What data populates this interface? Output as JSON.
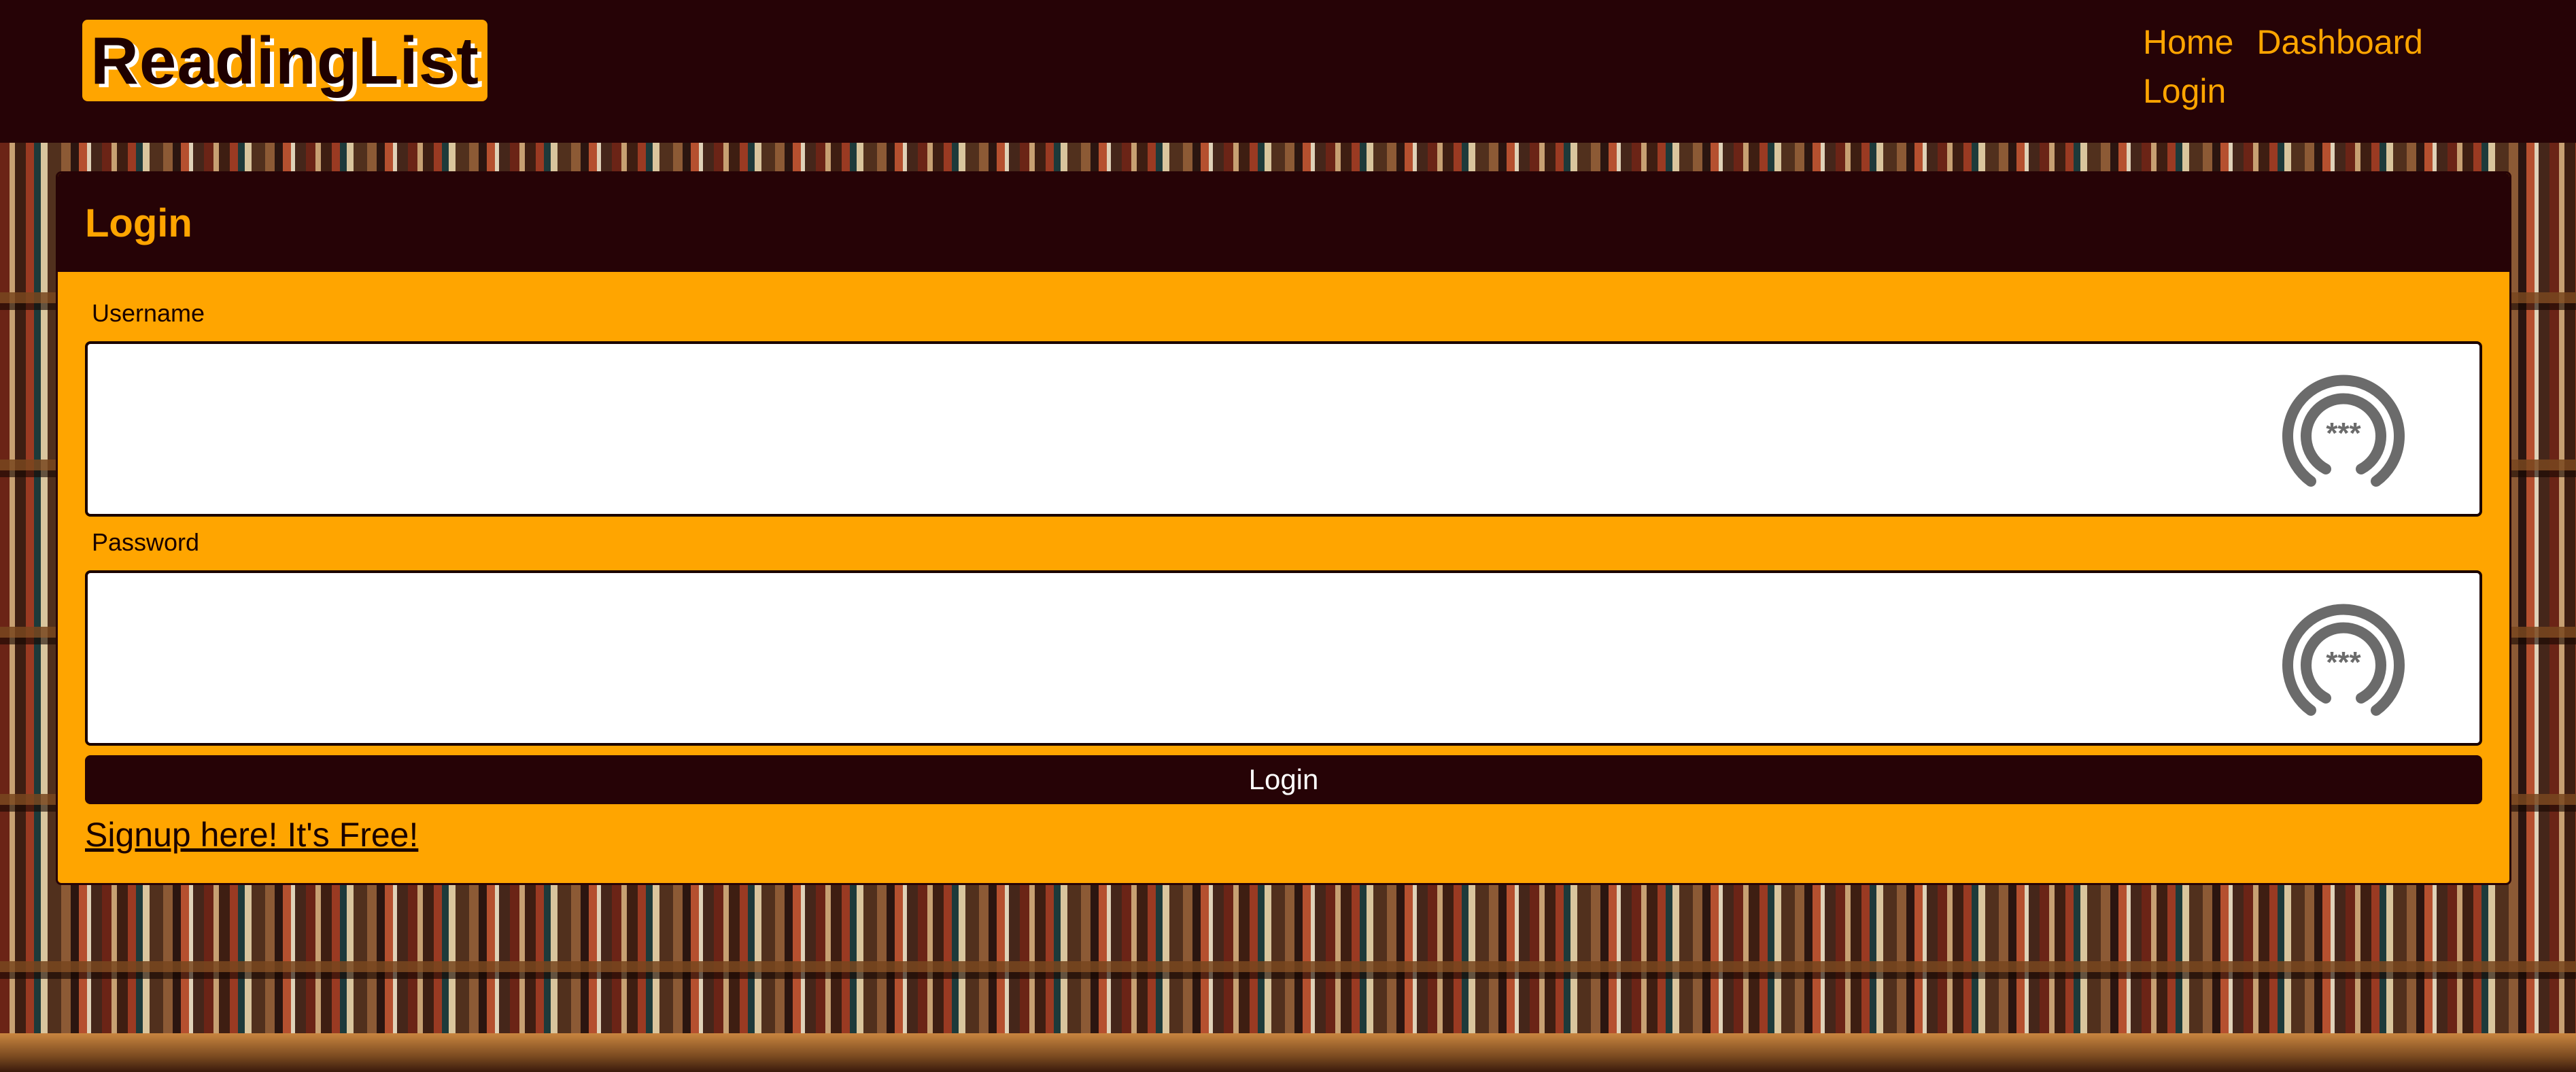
{
  "header": {
    "logo_text": "ReadingList",
    "nav": [
      {
        "label": "Home"
      },
      {
        "label": "Dashboard"
      },
      {
        "label": "Login"
      }
    ]
  },
  "login_card": {
    "title": "Login",
    "username_label": "Username",
    "username_value": "",
    "password_label": "Password",
    "password_value": "",
    "field_icon": "password-manager-icon",
    "submit_label": "Login",
    "signup_link": "Signup here! It's Free!"
  },
  "colors": {
    "accent": "#ffa500",
    "dark": "#260306"
  }
}
